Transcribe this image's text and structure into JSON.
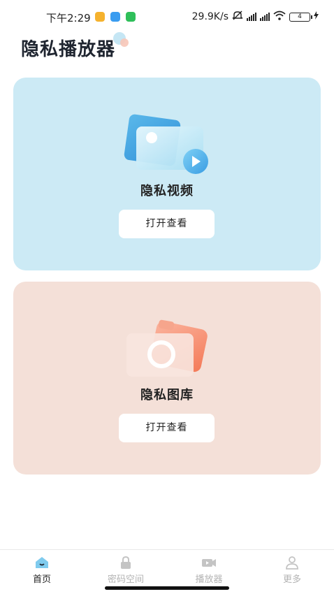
{
  "status_bar": {
    "time": "下午2:29",
    "net_speed": "29.9K/s",
    "battery": "4"
  },
  "app": {
    "title": "隐私播放器"
  },
  "cards": {
    "video": {
      "label": "隐私视频",
      "button": "打开查看",
      "bg": "#cceaf5"
    },
    "gallery": {
      "label": "隐私图库",
      "button": "打开查看",
      "bg": "#f4e0d8"
    }
  },
  "bottom_nav": {
    "items": [
      {
        "label": "首页",
        "icon": "home-icon",
        "active": true
      },
      {
        "label": "密码空间",
        "icon": "lock-icon",
        "active": false
      },
      {
        "label": "播放器",
        "icon": "video-camera-icon",
        "active": false
      },
      {
        "label": "更多",
        "icon": "user-icon",
        "active": false
      }
    ]
  },
  "colors": {
    "accent_blue": "#5ab8ea",
    "accent_orange": "#f48a6a",
    "inactive_text": "#b3b3b3"
  }
}
